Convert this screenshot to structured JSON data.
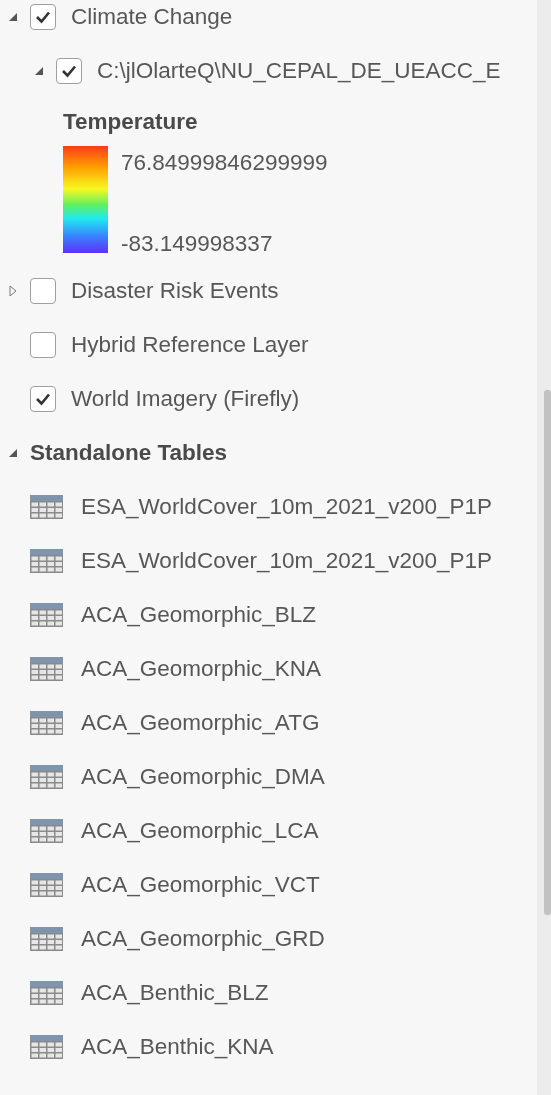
{
  "layers": [
    {
      "kind": "group",
      "label": "Climate Change",
      "checked": true,
      "expanded": true,
      "children": [
        {
          "kind": "group",
          "label": "C:\\jlOlarteQ\\NU_CEPAL_DE_UEACC_E",
          "checked": true,
          "expanded": true,
          "legend": {
            "title": "Temperature",
            "high": "76.84999846299999",
            "low": "-83.149998337"
          }
        }
      ]
    },
    {
      "kind": "group",
      "label": "Disaster Risk Events",
      "checked": false,
      "expanded": false
    },
    {
      "kind": "layer",
      "label": "Hybrid Reference Layer",
      "checked": false
    },
    {
      "kind": "layer",
      "label": "World Imagery (Firefly)",
      "checked": true
    }
  ],
  "standalone_tables": {
    "label": "Standalone Tables",
    "expanded": true,
    "items": [
      "ESA_WorldCover_10m_2021_v200_P1P",
      "ESA_WorldCover_10m_2021_v200_P1P",
      "ACA_Geomorphic_BLZ",
      "ACA_Geomorphic_KNA",
      "ACA_Geomorphic_ATG",
      "ACA_Geomorphic_DMA",
      "ACA_Geomorphic_LCA",
      "ACA_Geomorphic_VCT",
      "ACA_Geomorphic_GRD",
      "ACA_Benthic_BLZ",
      "ACA_Benthic_KNA"
    ]
  }
}
